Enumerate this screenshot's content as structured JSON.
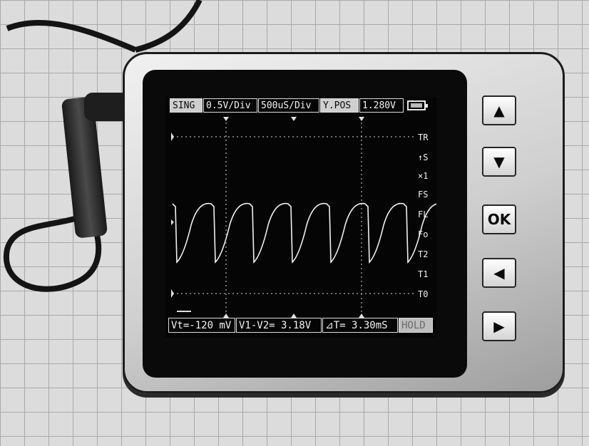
{
  "status_bar": {
    "mode": "SING",
    "volts_div": "0.5V/Div",
    "time_div": "500uS/Div",
    "ypos_label": "Y.POS",
    "ypos_value": "1.280V"
  },
  "side_labels": [
    "TR",
    "↑S",
    "×1",
    "FS",
    "FL",
    "Fo",
    "T2",
    "T1",
    "T0"
  ],
  "measurements": {
    "vt": "Vt=-120 mV",
    "v1_v2": "V1-V2= 3.18V",
    "delta_t": "⊿T= 3.30mS",
    "hold": "HOLD"
  },
  "buttons": {
    "up": "▲",
    "down": "▼",
    "ok": "OK",
    "left": "◀",
    "right": "▶"
  },
  "colors": {
    "screen_bg": "#050505",
    "trace": "#f0f0f0"
  },
  "icons": [
    "battery-icon",
    "up-arrow-icon",
    "down-arrow-icon",
    "left-arrow-icon",
    "right-arrow-icon"
  ]
}
